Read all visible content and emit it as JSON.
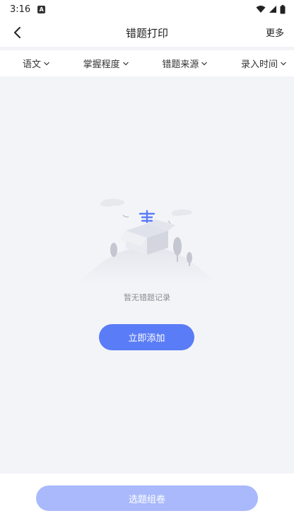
{
  "status_bar": {
    "time": "3:16",
    "app_icon": "A"
  },
  "nav": {
    "title": "错题打印",
    "more_label": "更多"
  },
  "filters": [
    {
      "label": "语文"
    },
    {
      "label": "掌握程度"
    },
    {
      "label": "错题来源"
    },
    {
      "label": "录入时间"
    }
  ],
  "empty_state": {
    "text": "暂无错题记录",
    "illustration_icon": "empty-box-icon"
  },
  "actions": {
    "add_label": "立即添加",
    "compose_label": "选题组卷"
  },
  "colors": {
    "primary": "#5a7cf6",
    "disabled_primary": "#a9b9fb",
    "background": "#f3f4f8"
  }
}
